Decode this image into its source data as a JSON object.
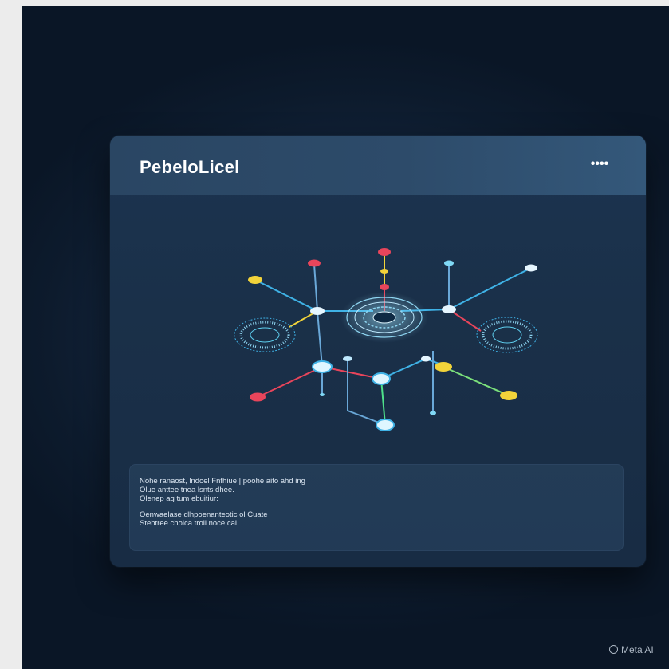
{
  "window": {
    "title": "PebeloLicel",
    "menu_icon": "more-dots-icon"
  },
  "diagram": {
    "icon": "network-graph-illustration"
  },
  "info_panel": {
    "lines": [
      "Nohe ranaost, lndoel Fnfhiue | poohe aito ahd ing",
      "Olue anttee tnea lsnts dhee.",
      "Olenep ag tum ebuitiur:",
      "Oenwaelase dlhpoenanteotic ol Cuate",
      "Stebtree choica troil noce cal"
    ]
  },
  "watermark": {
    "text": "Meta AI"
  },
  "colors": {
    "background": "#0d1b2d",
    "window": "#1a3049",
    "titlebar": "#2d4b6a",
    "node_red": "#e8455b",
    "node_yellow": "#f2d33a",
    "node_cyan": "#5fd0f0",
    "node_green": "#4ee08a"
  }
}
